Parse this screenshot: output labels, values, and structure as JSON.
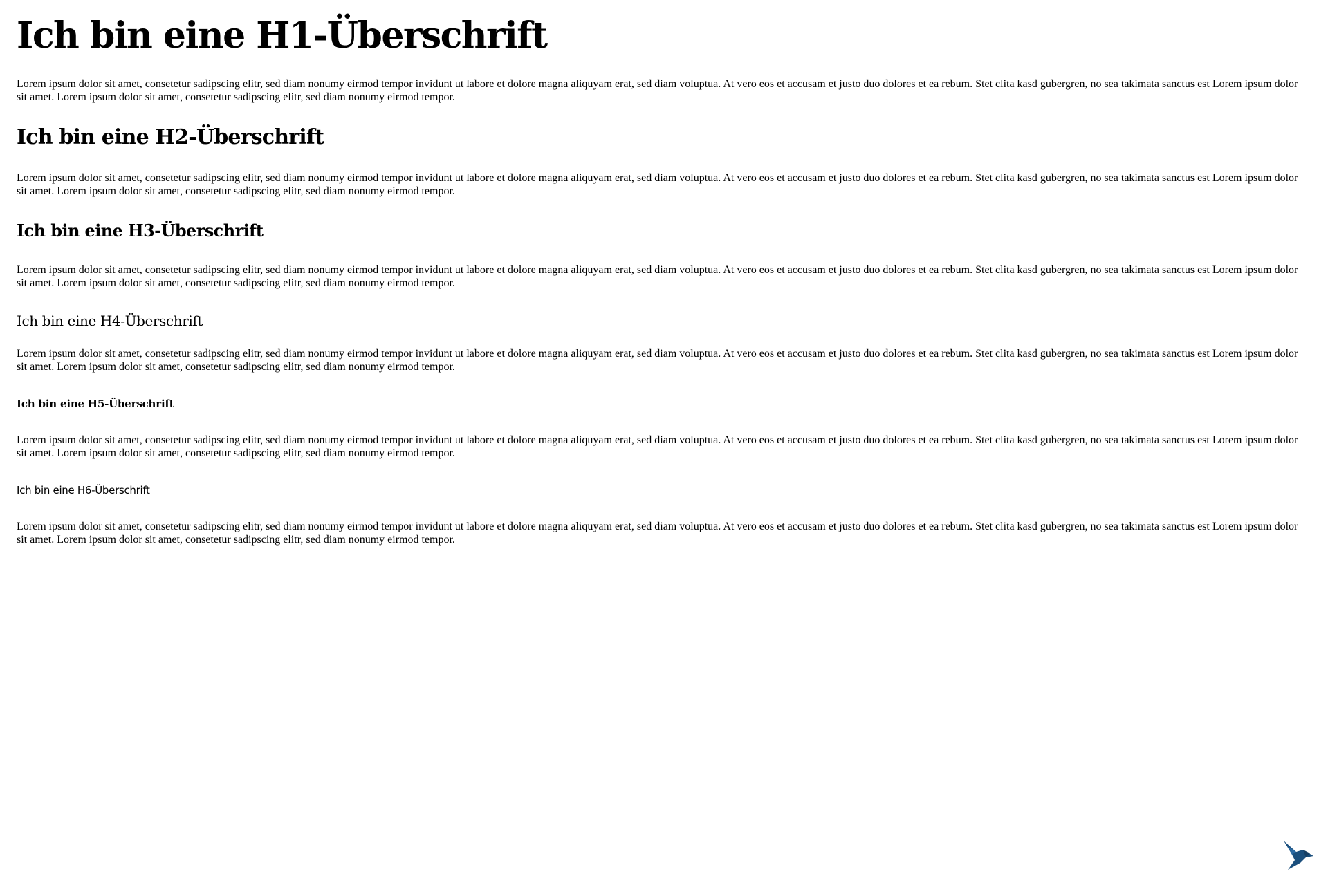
{
  "headings": {
    "h1": "Ich bin eine H1-Überschrift",
    "h2": "Ich bin eine H2-Überschrift",
    "h3": "Ich bin eine H3-Überschrift",
    "h4": "Ich bin eine H4-Überschrift",
    "h5": "Ich bin eine H5-Überschrift",
    "h6": "Ich bin eine H6-Überschrift"
  },
  "paragraphs": [
    "Lorem ipsum dolor sit amet, consetetur sadipscing elitr, sed diam nonumy eirmod tempor invidunt ut labore et dolore magna aliquyam erat, sed diam voluptua. At vero eos et accusam et justo duo dolores et ea rebum. Stet clita kasd gubergren, no sea takimata sanctus est Lorem ipsum dolor sit amet. Lorem ipsum dolor sit amet, consetetur sadipscing elitr, sed diam nonumy eirmod tempor.",
    "Lorem ipsum dolor sit amet, consetetur sadipscing elitr, sed diam nonumy eirmod tempor invidunt ut labore et dolore magna aliquyam erat, sed diam voluptua. At vero eos et accusam et justo duo dolores et ea rebum. Stet clita kasd gubergren, no sea takimata sanctus est Lorem ipsum dolor sit amet. Lorem ipsum dolor sit amet, consetetur sadipscing elitr, sed diam nonumy eirmod tempor.",
    "Lorem ipsum dolor sit amet, consetetur sadipscing elitr, sed diam nonumy eirmod tempor invidunt ut labore et dolore magna aliquyam erat, sed diam voluptua. At vero eos et accusam et justo duo dolores et ea rebum. Stet clita kasd gubergren, no sea takimata sanctus est Lorem ipsum dolor sit amet. Lorem ipsum dolor sit amet, consetetur sadipscing elitr, sed diam nonumy eirmod tempor.",
    "Lorem ipsum dolor sit amet, consetetur sadipscing elitr, sed diam nonumy eirmod tempor invidunt ut labore et dolore magna aliquyam erat, sed diam voluptua. At vero eos et accusam et justo duo dolores et ea rebum. Stet clita kasd gubergren, no sea takimata sanctus est Lorem ipsum dolor sit amet. Lorem ipsum dolor sit amet, consetetur sadipscing elitr, sed diam nonumy eirmod tempor.",
    "Lorem ipsum dolor sit amet, consetetur sadipscing elitr, sed diam nonumy eirmod tempor invidunt ut labore et dolore magna aliquyam erat, sed diam voluptua. At vero eos et accusam et justo duo dolores et ea rebum. Stet clita kasd gubergren, no sea takimata sanctus est Lorem ipsum dolor sit amet. Lorem ipsum dolor sit amet, consetetur sadipscing elitr, sed diam nonumy eirmod tempor.",
    "Lorem ipsum dolor sit amet, consetetur sadipscing elitr, sed diam nonumy eirmod tempor invidunt ut labore et dolore magna aliquyam erat, sed diam voluptua. At vero eos et accusam et justo duo dolores et ea rebum. Stet clita kasd gubergren, no sea takimata sanctus est Lorem ipsum dolor sit amet. Lorem ipsum dolor sit amet, consetetur sadipscing elitr, sed diam nonumy eirmod tempor."
  ],
  "logo": {
    "icon": "hummingbird-icon",
    "color": "#1b4f7d"
  }
}
